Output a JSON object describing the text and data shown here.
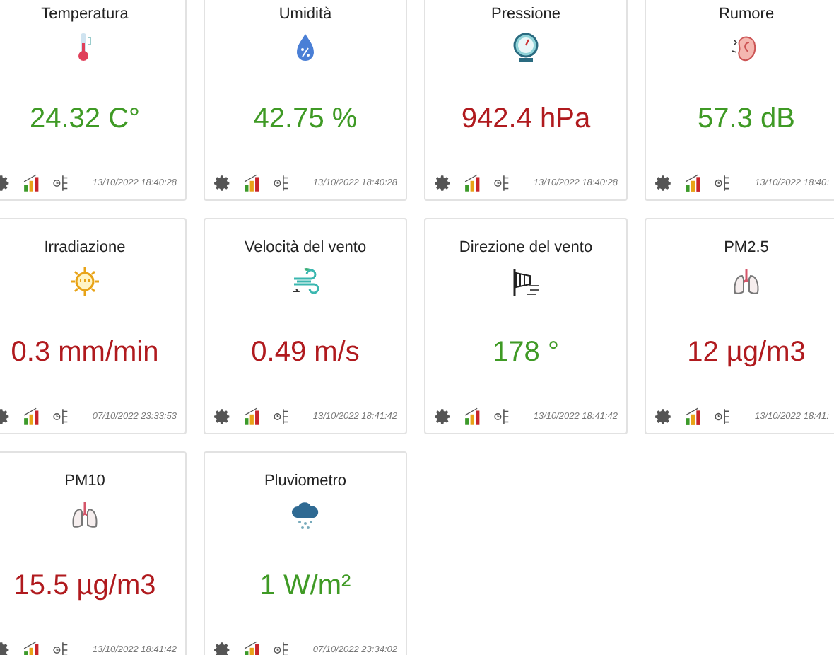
{
  "sensors": [
    {
      "kind": "temperature",
      "title": "Temperatura",
      "value": "24.32 C°",
      "color": "#3f9a25",
      "timestamp": "13/10/2022 18:40:28"
    },
    {
      "kind": "humidity",
      "title": "Umidità",
      "value": "42.75 %",
      "color": "#3f9a25",
      "timestamp": "13/10/2022 18:40:28"
    },
    {
      "kind": "pressure",
      "title": "Pressione",
      "value": "942.4 hPa",
      "color": "#b01a1e",
      "timestamp": "13/10/2022 18:40:28"
    },
    {
      "kind": "noise",
      "title": "Rumore",
      "value": "57.3 dB",
      "color": "#3f9a25",
      "timestamp": "13/10/2022 18:40:"
    },
    {
      "kind": "sun",
      "title": "Irradiazione",
      "value": "0.3 mm/min",
      "color": "#b01a1e",
      "timestamp": "07/10/2022 23:33:53"
    },
    {
      "kind": "wind",
      "title": "Velocità del vento",
      "value": "0.49 m/s",
      "color": "#b01a1e",
      "timestamp": "13/10/2022 18:41:42"
    },
    {
      "kind": "windsock",
      "title": "Direzione del vento",
      "value": "178 °",
      "color": "#3f9a25",
      "timestamp": "13/10/2022 18:41:42"
    },
    {
      "kind": "lungs",
      "title": "PM2.5",
      "value": "12 µg/m3",
      "color": "#b01a1e",
      "timestamp": "13/10/2022 18:41:"
    },
    {
      "kind": "lungs",
      "title": "PM10",
      "value": "15.5 µg/m3",
      "color": "#b01a1e",
      "timestamp": "13/10/2022 18:41:42"
    },
    {
      "kind": "rain",
      "title": "Pluviometro",
      "value": "1 W/m²",
      "color": "#3f9a25",
      "timestamp": "07/10/2022 23:34:02"
    }
  ]
}
